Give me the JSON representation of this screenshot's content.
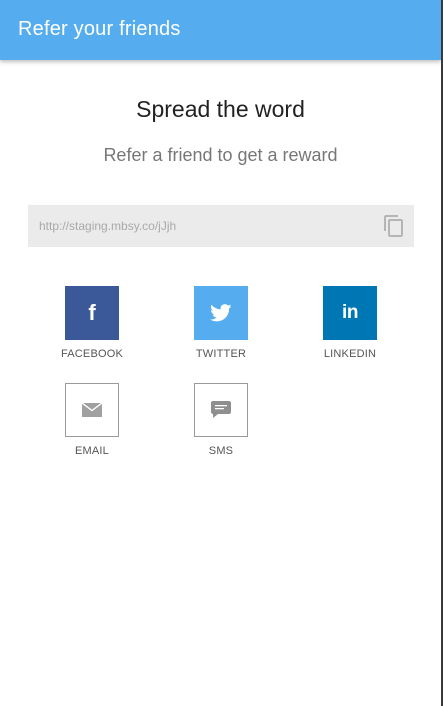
{
  "app_bar": {
    "title": "Refer your friends",
    "color": "#55acee"
  },
  "header": {
    "headline": "Spread the word",
    "subhead": "Refer a friend to get a reward"
  },
  "referral_link": {
    "url": "http://staging.mbsy.co/jJjh",
    "copy_icon": "copy-icon"
  },
  "share_options": [
    {
      "label": "FACEBOOK",
      "icon": "facebook-icon",
      "color": "#3b5998"
    },
    {
      "label": "TWITTER",
      "icon": "twitter-icon",
      "color": "#55acee"
    },
    {
      "label": "LINKEDIN",
      "icon": "linkedin-icon",
      "color": "#0077b5"
    },
    {
      "label": "EMAIL",
      "icon": "email-icon",
      "color": "#9a9a9a"
    },
    {
      "label": "SMS",
      "icon": "sms-icon",
      "color": "#9a9a9a"
    }
  ]
}
